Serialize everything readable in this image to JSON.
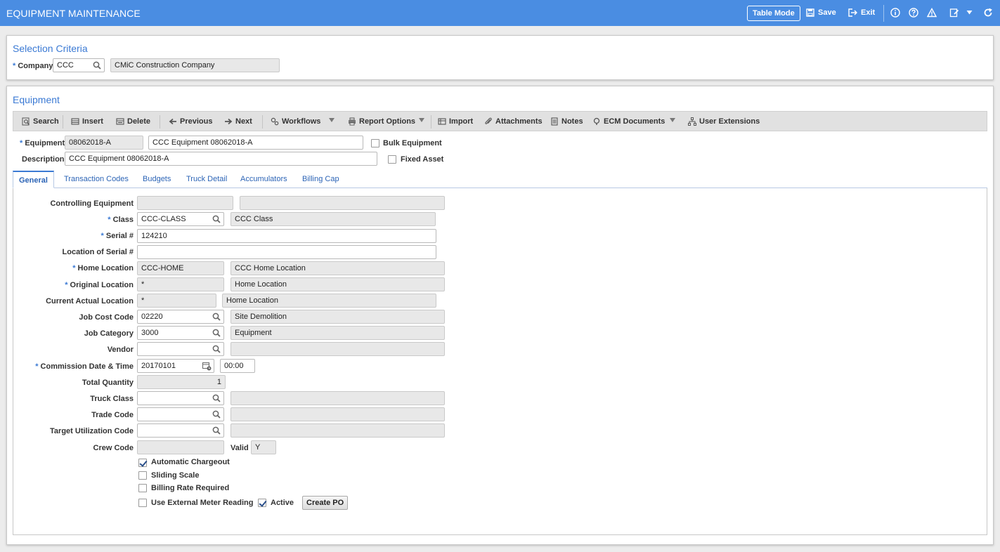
{
  "topbar": {
    "title": "EQUIPMENT MAINTENANCE",
    "table_mode": "Table Mode",
    "save": "Save",
    "exit": "Exit"
  },
  "selection": {
    "title": "Selection Criteria",
    "company_label": "Company",
    "company_value": "CCC",
    "company_name": "CMiC Construction Company"
  },
  "equipment": {
    "title": "Equipment",
    "toolbar": {
      "search": "Search",
      "insert": "Insert",
      "delete": "Delete",
      "previous": "Previous",
      "next": "Next",
      "workflows": "Workflows",
      "report_options": "Report Options",
      "import": "Import",
      "attachments": "Attachments",
      "notes": "Notes",
      "ecm_documents": "ECM Documents",
      "user_extensions": "User Extensions"
    },
    "equipment_label": "Equipment",
    "equipment_code": "08062018-A",
    "equipment_name": "CCC Equipment 08062018-A",
    "bulk_equipment": "Bulk Equipment",
    "description_label": "Description",
    "description_value": "CCC Equipment 08062018-A",
    "fixed_asset": "Fixed Asset"
  },
  "tabs": [
    "General",
    "Transaction Codes",
    "Budgets",
    "Truck Detail",
    "Accumulators",
    "Billing Cap"
  ],
  "general": {
    "controlling_equipment": {
      "label": "Controlling Equipment",
      "code": "",
      "desc": ""
    },
    "class": {
      "label": "Class",
      "code": "CCC-CLASS",
      "desc": "CCC Class"
    },
    "serial": {
      "label": "Serial #",
      "value": "124210"
    },
    "location_of_serial": {
      "label": "Location of Serial #",
      "value": ""
    },
    "home_location": {
      "label": "Home Location",
      "code": "CCC-HOME",
      "desc": "CCC Home Location"
    },
    "original_location": {
      "label": "Original Location",
      "code": "*",
      "desc": "Home Location"
    },
    "current_actual_location": {
      "label": "Current Actual Location",
      "code": "*",
      "desc": "Home Location"
    },
    "job_cost_code": {
      "label": "Job Cost Code",
      "code": "02220",
      "desc": "Site Demolition"
    },
    "job_category": {
      "label": "Job Category",
      "code": "3000",
      "desc": "Equipment"
    },
    "vendor": {
      "label": "Vendor",
      "code": "",
      "desc": ""
    },
    "commission": {
      "label": "Commission Date & Time",
      "date": "20170101",
      "time": "00:00"
    },
    "total_quantity": {
      "label": "Total Quantity",
      "value": "1"
    },
    "truck_class": {
      "label": "Truck Class",
      "code": "",
      "desc": ""
    },
    "trade_code": {
      "label": "Trade Code",
      "code": "",
      "desc": ""
    },
    "target_utilization_code": {
      "label": "Target Utilization Code",
      "code": "",
      "desc": ""
    },
    "crew_code": {
      "label": "Crew Code",
      "value": ""
    },
    "valid": {
      "label": "Valid",
      "value": "Y"
    },
    "automatic_chargeout": {
      "label": "Automatic Chargeout",
      "checked": true
    },
    "sliding_scale": {
      "label": "Sliding Scale",
      "checked": false
    },
    "billing_rate_required": {
      "label": "Billing Rate Required",
      "checked": false
    },
    "use_external_meter_reading": {
      "label": "Use External Meter Reading",
      "checked": false
    },
    "active": {
      "label": "Active",
      "checked": true
    },
    "create_po": "Create PO"
  },
  "colors": {
    "header_bg": "#4a8de2",
    "accent": "#3b7ad4",
    "tab_text": "#2c64b6"
  }
}
